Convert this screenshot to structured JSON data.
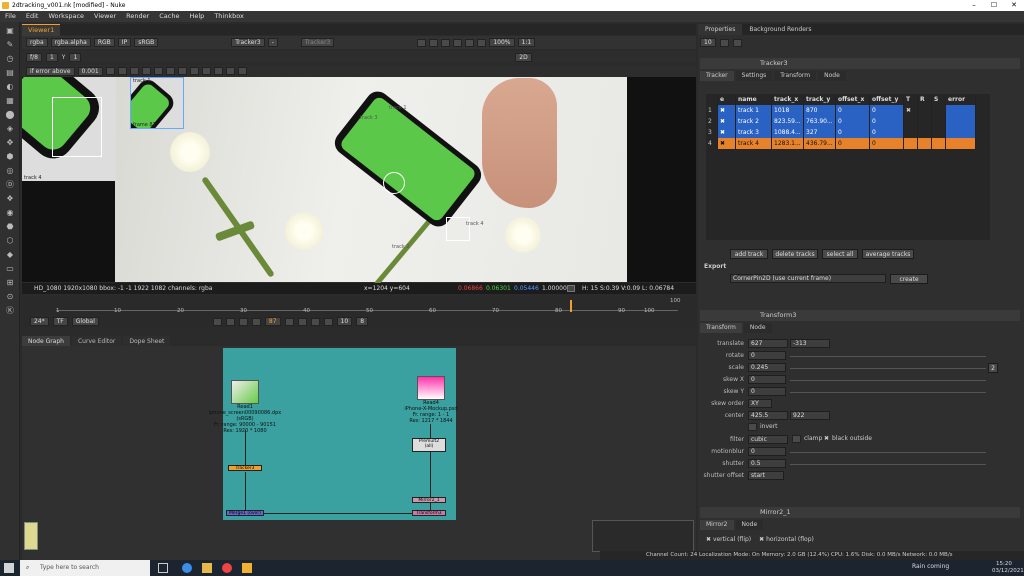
{
  "window": {
    "title": "2dtracking_v001.nk [modified] - Nuke"
  },
  "menu": [
    "File",
    "Edit",
    "Workspace",
    "Viewer",
    "Render",
    "Cache",
    "Help",
    "Thinkbox"
  ],
  "viewer": {
    "tab": "Viewer1",
    "channels": "rgba",
    "alpha": "rgba.alpha",
    "colorspace": "RGB",
    "ip": "IP",
    "display": "sRGB",
    "input_a": "Tracker3",
    "input_a_extra": "-",
    "input_b": "Tracker3",
    "zoom": "100%",
    "ratio": "1:1",
    "mode": "2D",
    "fstop": "f/8",
    "frame_field": "1",
    "y_label": "Y",
    "y_value": "1",
    "error_mode": "if error above",
    "error_value": "0.001",
    "tracks": [
      "track 1",
      "track 2",
      "track 3",
      "track 4"
    ],
    "zoom_label_1": "track 4",
    "zoom_label_2": "track 1",
    "zoom_frame": "frame 87",
    "info_left": "HD_1080 1920x1080  bbox: -1 -1 1922 1082 channels: rgba",
    "info_coords": "x=1204 y=604",
    "info_r": "0.06866",
    "info_g": "0.06301",
    "info_b": "0.05446",
    "info_a": "1.00000",
    "info_hsv": "H: 15 S:0.39 V:0.09  L: 0.06784"
  },
  "timeline": {
    "ticks": [
      "1",
      "10",
      "20",
      "30",
      "40",
      "50",
      "60",
      "70",
      "80",
      "90",
      "100"
    ],
    "end_label": "100",
    "fps": "24*",
    "tf": "TF",
    "range": "Global",
    "frame": "87",
    "increment": "10",
    "step": "8"
  },
  "panes": {
    "node_graph": "Node Graph",
    "curve_editor": "Curve Editor",
    "dope_sheet": "Dope Sheet"
  },
  "nodes": {
    "read1": {
      "name": "Read1",
      "info": "iphone_screen00090086.dpx (sRGB)",
      "range": "Fr. range: 90000 - 90151",
      "res": "Res: 1920 * 1080"
    },
    "read4": {
      "name": "Read4",
      "info": "iPhone-X-Mockup.psd",
      "range": "Fr. range: 1 - 1",
      "res": "Res: 1217 * 1844"
    },
    "tracker3": "Tracker3",
    "premult": "Premult2",
    "premult_sub": "(all)",
    "mirror": "Mirror2_1",
    "transform": "Transform3",
    "merge": "Merge1 (over)"
  },
  "properties": {
    "tabs": [
      "Properties",
      "Background Renders"
    ],
    "max_panels": "10",
    "tracker": {
      "title": "Tracker3",
      "tabs": [
        "Tracker",
        "Settings",
        "Transform",
        "Node"
      ],
      "headers": [
        "e",
        "name",
        "track_x",
        "track_y",
        "offset_x",
        "offset_y",
        "T",
        "R",
        "S",
        "error"
      ],
      "rows": [
        {
          "idx": "1",
          "name": "track 1",
          "x": "1018",
          "y": "870",
          "ox": "0",
          "oy": "0",
          "color": "blue"
        },
        {
          "idx": "2",
          "name": "track 2",
          "x": "823.59...",
          "y": "763.90...",
          "ox": "0",
          "oy": "0",
          "color": "blue"
        },
        {
          "idx": "3",
          "name": "track 3",
          "x": "1088.4...",
          "y": "327",
          "ox": "0",
          "oy": "0",
          "color": "blue"
        },
        {
          "idx": "4",
          "name": "track 4",
          "x": "1283.1...",
          "y": "436.79...",
          "ox": "0",
          "oy": "0",
          "color": "orange"
        }
      ],
      "buttons": [
        "add track",
        "delete tracks",
        "select all",
        "average tracks"
      ],
      "export_label": "Export",
      "export_value": "CornerPin2D (use current frame)",
      "create": "create"
    },
    "transform": {
      "title": "Transform3",
      "tabs": [
        "Transform",
        "Node"
      ],
      "translate_label": "translate",
      "translate_x": "627",
      "translate_y": "-313",
      "rotate_label": "rotate",
      "rotate": "0",
      "scale_label": "scale",
      "scale": "0.245",
      "skewx_label": "skew X",
      "skewx": "0",
      "skewy_label": "skew Y",
      "skewy": "0",
      "skeworder_label": "skew order",
      "skeworder": "XY",
      "center_label": "center",
      "center_x": "425.5",
      "center_y": "922",
      "invert": "invert",
      "filter_label": "filter",
      "filter": "cubic",
      "clamp": "clamp",
      "black_outside": "black outside",
      "motionblur_label": "motionblur",
      "motionblur": "0",
      "shutter_label": "shutter",
      "shutter": "0.5",
      "shutteroffset_label": "shutter offset",
      "shutteroffset": "start",
      "scale_btn": "2"
    },
    "mirror": {
      "title": "Mirror2_1",
      "tabs": [
        "Mirror2",
        "Node"
      ],
      "vertical": "vertical (flip)",
      "horizontal": "horizontal (flop)"
    }
  },
  "status": "Channel Count: 24  Localization Mode: On  Memory: 2.0 GB (12.4%)  CPU: 1.6%  Disk: 0.0 MB/s  Network: 0.0 MB/s",
  "taskbar": {
    "search": "Type here to search",
    "weather": "Rain coming",
    "time": "15:20",
    "date": "03/12/2021"
  }
}
